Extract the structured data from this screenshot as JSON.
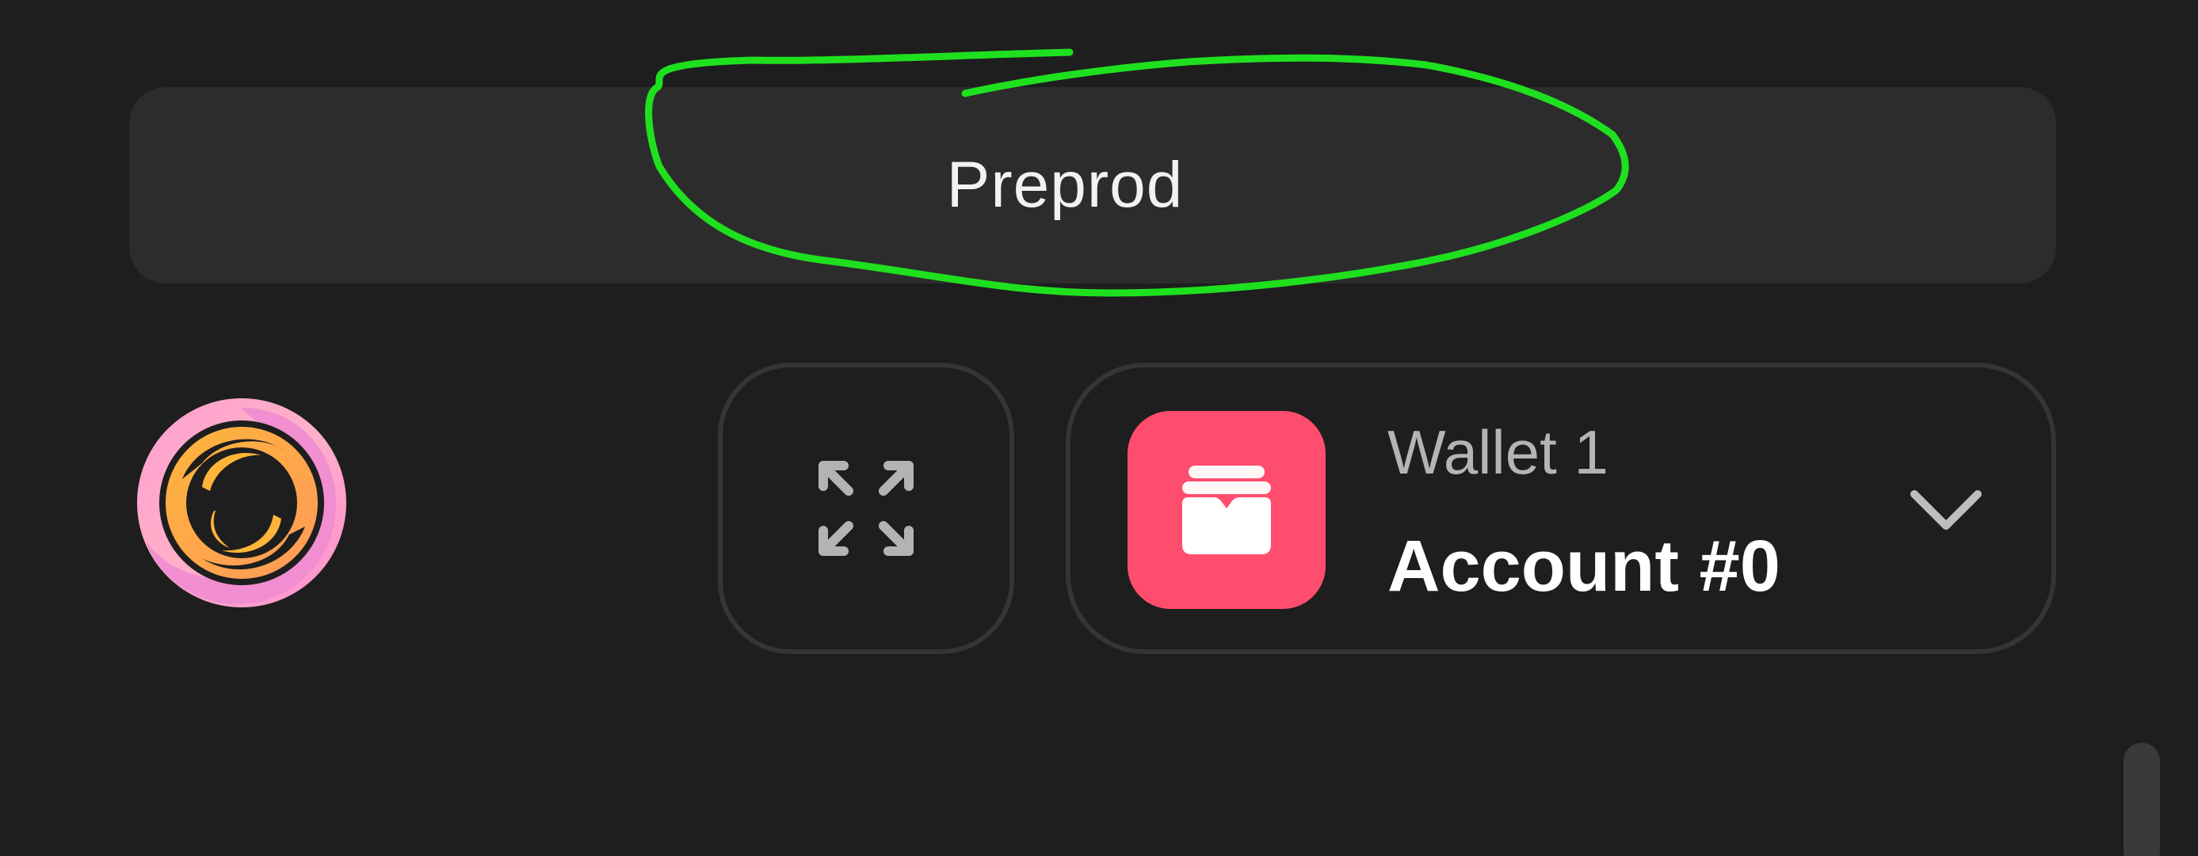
{
  "network": {
    "label": "Preprod"
  },
  "logo": {
    "icon": "swirl-logo-icon"
  },
  "expand": {
    "icon": "expand-icon"
  },
  "wallet": {
    "wallet_name": "Wallet 1",
    "account_name": "Account #0",
    "avatar_icon": "wallet-icon",
    "avatar_color": "#ff4d6d",
    "chevron_icon": "chevron-down-icon"
  },
  "annotation": {
    "color": "#1fe01f"
  },
  "colors": {
    "background": "#1e1e1e",
    "banner": "#2c2c2c",
    "border": "#353535"
  }
}
